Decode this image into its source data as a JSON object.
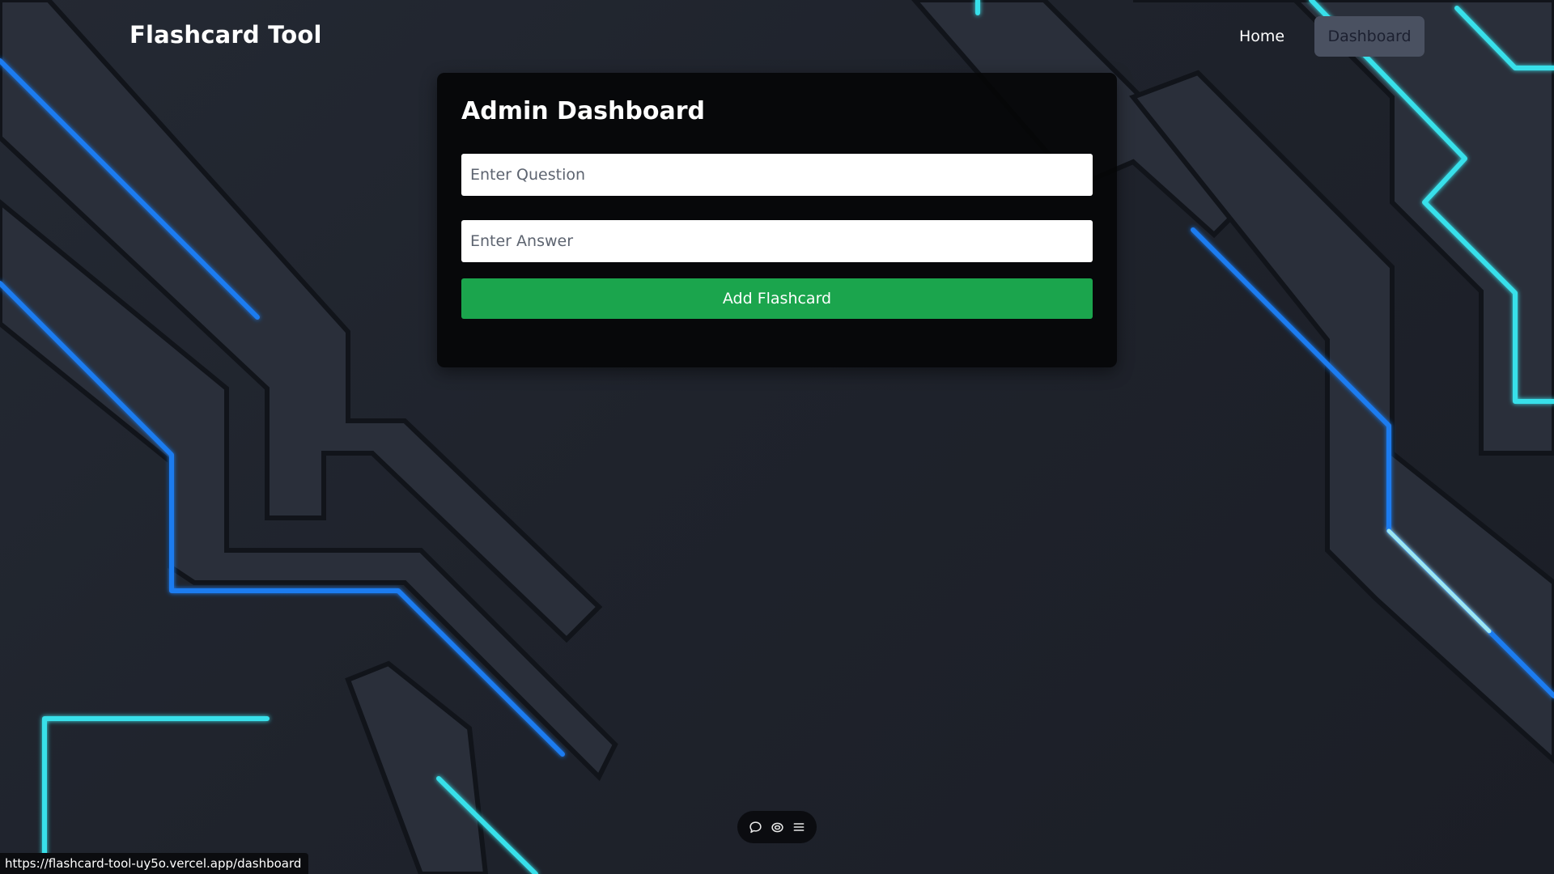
{
  "app": {
    "brand": "Flashcard Tool"
  },
  "nav": {
    "home_label": "Home",
    "dashboard_label": "Dashboard"
  },
  "form": {
    "title": "Admin Dashboard",
    "question_placeholder": "Enter Question",
    "question_value": "",
    "answer_placeholder": "Enter Answer",
    "answer_value": "",
    "submit_label": "Add Flashcard"
  },
  "toolbar": {
    "icons": [
      "comment-icon",
      "eye-icon",
      "menu-icon"
    ]
  },
  "status_bar": {
    "url": "https://flashcard-tool-uy5o.vercel.app/dashboard"
  },
  "colors": {
    "background": "#1f232c",
    "card": "#050608",
    "primary_button": "#1ba54d",
    "active_nav": "#4a5161",
    "circuit_blue": "#1e7bf0",
    "circuit_cyan": "#38e0ea"
  }
}
